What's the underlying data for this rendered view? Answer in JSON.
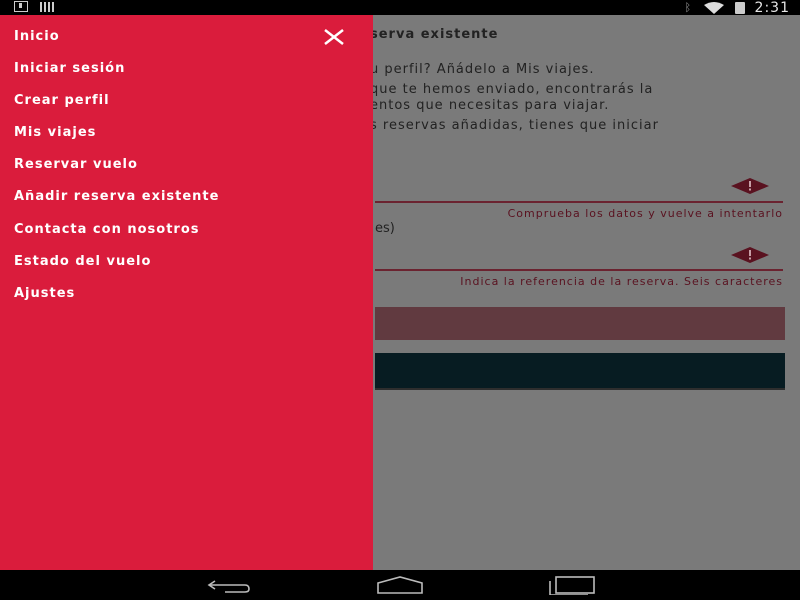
{
  "status_bar": {
    "time": "2:31",
    "icons": [
      "download-icon",
      "signal-bars-icon",
      "bluetooth-icon",
      "wifi-icon",
      "battery-charging-icon"
    ]
  },
  "background": {
    "title": "serva existente",
    "paragraphs": [
      "u perfil? Añádelo a Mis viajes.",
      " que te hemos enviado, encontrarás la",
      "entos que necesitas para viajar.",
      "s reservas añadidas, tienes que iniciar"
    ],
    "field_error_1": "Comprueba los datos y vuelve a intentarlo",
    "field_label_2": "es)",
    "field_error_2": "Indica la referencia de la reserva. Seis caracteres",
    "colors": {
      "error": "#5a1220",
      "dim_overlay": "#7a7a7a"
    }
  },
  "drawer": {
    "background": "#da1c3c",
    "close_icon": "close-icon",
    "items": [
      {
        "label": "Inicio"
      },
      {
        "label": "Iniciar sesión"
      },
      {
        "label": "Crear perfil"
      },
      {
        "label": "Mis viajes"
      },
      {
        "label": "Reservar vuelo"
      },
      {
        "label": "Añadir reserva existente"
      },
      {
        "label": "Contacta con nosotros"
      },
      {
        "label": "Estado del vuelo"
      },
      {
        "label": "Ajustes"
      }
    ]
  },
  "nav_bar": {
    "buttons": [
      "back-icon",
      "home-icon",
      "recents-icon"
    ]
  }
}
